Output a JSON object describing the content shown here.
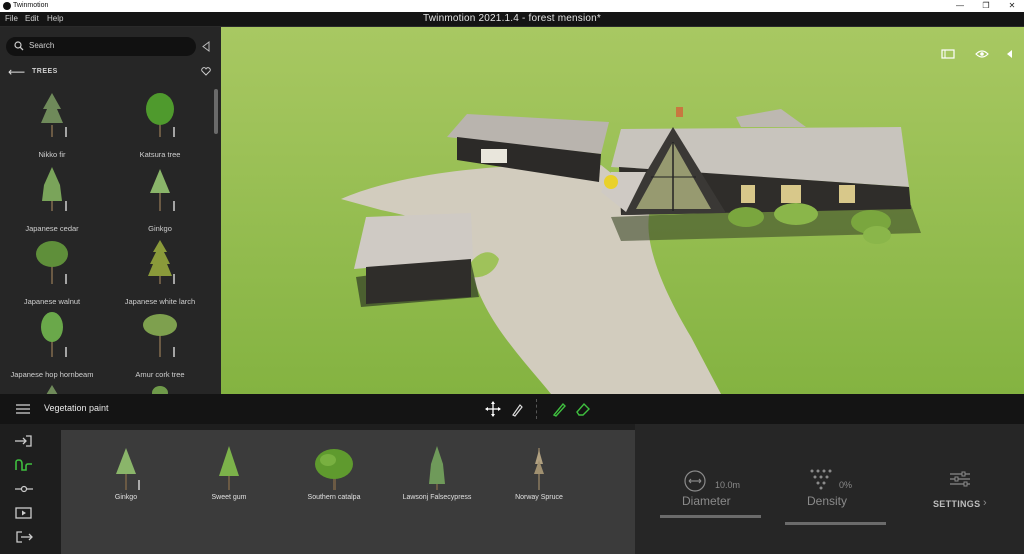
{
  "window": {
    "app_name": "Twinmotion",
    "document_title": "Twinmotion 2021.1.4 - forest mension*",
    "controls": [
      "minimize",
      "restore",
      "close"
    ]
  },
  "menu": [
    "File",
    "Edit",
    "Help"
  ],
  "library": {
    "search_placeholder": "Search",
    "category": "TREES",
    "items": [
      {
        "label": "Nikko fir"
      },
      {
        "label": "Katsura tree"
      },
      {
        "label": "Japanese cedar"
      },
      {
        "label": "Ginkgo"
      },
      {
        "label": "Japanese walnut"
      },
      {
        "label": "Japanese white larch"
      },
      {
        "label": "Japanese hop hornbeam"
      },
      {
        "label": "Amur cork tree"
      }
    ]
  },
  "viewport": {
    "icons": [
      "panel-toggle-icon",
      "eye-icon",
      "collapse-right-icon"
    ]
  },
  "toolbar": {
    "title": "Vegetation paint",
    "tools": [
      "move-gizmo-icon",
      "pipette-icon",
      "brush-icon",
      "eraser-icon"
    ]
  },
  "left_rail": {
    "icons": [
      "import-icon",
      "paint-icon",
      "line-icon",
      "media-icon",
      "export-icon"
    ]
  },
  "palette": {
    "items": [
      {
        "label": "Ginkgo"
      },
      {
        "label": "Sweet gum"
      },
      {
        "label": "Southern catalpa"
      },
      {
        "label": "Lawsonj Falsecypress"
      },
      {
        "label": "Norway Spruce"
      }
    ]
  },
  "properties": {
    "diameter": {
      "label": "Diameter",
      "value": "10.0m"
    },
    "density": {
      "label": "Density",
      "value": "0%"
    },
    "settings_label": "SETTINGS"
  },
  "colors": {
    "accent_green": "#3fbf3f",
    "grass": "#a2c55b",
    "panel_bg": "#262626"
  }
}
